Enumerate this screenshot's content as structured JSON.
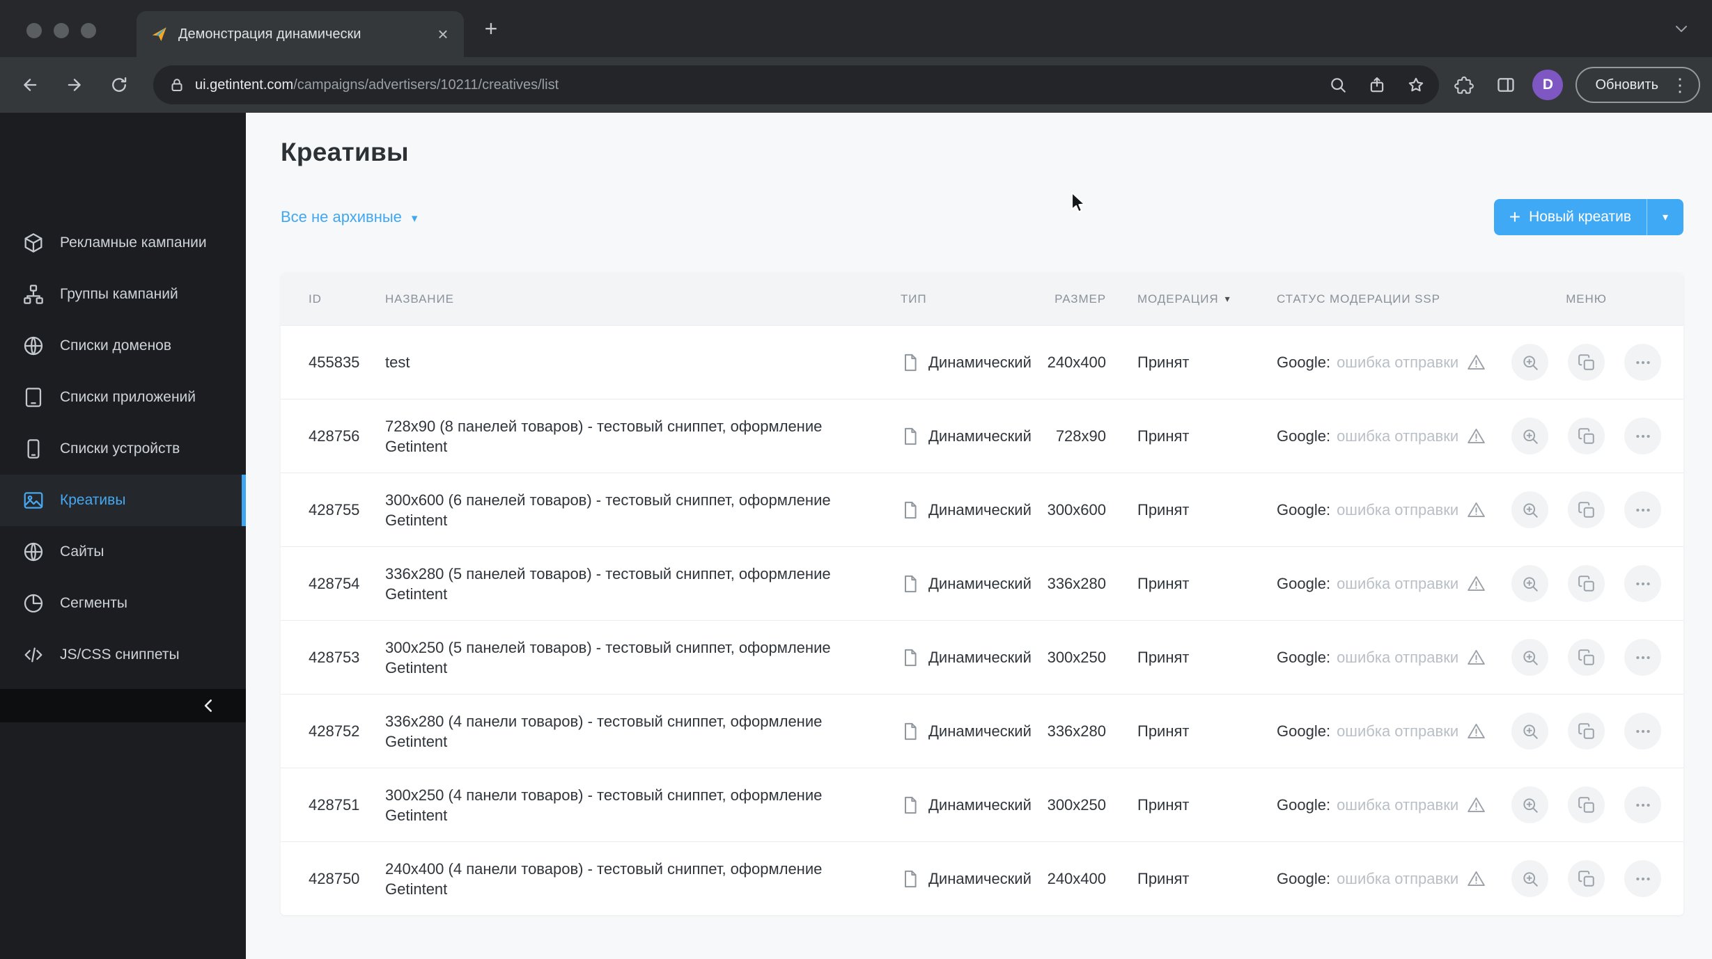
{
  "colors": {
    "accent": "#41a7ef",
    "sidebar_bg": "#1b1d20",
    "page_bg": "#f7f8f9"
  },
  "glyphs": {
    "caret_down": "▾",
    "close": "×",
    "plus": "+",
    "kebab": "⋮"
  },
  "browser": {
    "tab_title": "Демонстрация динамически",
    "url_host": "ui.getintent.com",
    "url_path": "/campaigns/advertisers/10211/creatives/list",
    "update_label": "Обновить",
    "avatar_letter": "D"
  },
  "sidebar": {
    "items": [
      {
        "label": "Рекламные кампании",
        "icon": "cube",
        "active": false
      },
      {
        "label": "Группы кампаний",
        "icon": "sitemap",
        "active": false
      },
      {
        "label": "Списки доменов",
        "icon": "globe",
        "active": false
      },
      {
        "label": "Списки приложений",
        "icon": "tablet",
        "active": false
      },
      {
        "label": "Списки устройств",
        "icon": "phone",
        "active": false
      },
      {
        "label": "Креативы",
        "icon": "image",
        "active": true
      },
      {
        "label": "Сайты",
        "icon": "globe",
        "active": false
      },
      {
        "label": "Сегменты",
        "icon": "pie",
        "active": false
      },
      {
        "label": "JS/CSS сниппеты",
        "icon": "code",
        "active": false
      }
    ]
  },
  "page": {
    "title": "Креативы",
    "filter_label": "Все не архивные",
    "new_creative_label": "Новый креатив"
  },
  "table": {
    "headers": {
      "id": "ID",
      "name": "НАЗВАНИЕ",
      "type": "ТИП",
      "size": "РАЗМЕР",
      "moderation": "МОДЕРАЦИЯ",
      "ssp": "СТАТУС МОДЕРАЦИИ SSP",
      "menu": "МЕНЮ"
    },
    "rows": [
      {
        "id": "455835",
        "name": "test",
        "type": "Динамический",
        "size": "240x400",
        "moderation": "Принят",
        "ssp_network": "Google:",
        "ssp_status": "ошибка отправки"
      },
      {
        "id": "428756",
        "name": "728x90 (8 панелей товаров) - тестовый сниппет, оформление Getintent",
        "type": "Динамический",
        "size": "728x90",
        "moderation": "Принят",
        "ssp_network": "Google:",
        "ssp_status": "ошибка отправки"
      },
      {
        "id": "428755",
        "name": "300x600 (6 панелей товаров) - тестовый сниппет, оформление Getintent",
        "type": "Динамический",
        "size": "300x600",
        "moderation": "Принят",
        "ssp_network": "Google:",
        "ssp_status": "ошибка отправки"
      },
      {
        "id": "428754",
        "name": "336x280 (5 панелей товаров) - тестовый сниппет, оформление Getintent",
        "type": "Динамический",
        "size": "336x280",
        "moderation": "Принят",
        "ssp_network": "Google:",
        "ssp_status": "ошибка отправки"
      },
      {
        "id": "428753",
        "name": "300x250 (5 панелей товаров) - тестовый сниппет, оформление Getintent",
        "type": "Динамический",
        "size": "300x250",
        "moderation": "Принят",
        "ssp_network": "Google:",
        "ssp_status": "ошибка отправки"
      },
      {
        "id": "428752",
        "name": "336x280 (4 панели товаров) - тестовый сниппет, оформление Getintent",
        "type": "Динамический",
        "size": "336x280",
        "moderation": "Принят",
        "ssp_network": "Google:",
        "ssp_status": "ошибка отправки"
      },
      {
        "id": "428751",
        "name": "300x250 (4 панели товаров) - тестовый сниппет, оформление Getintent",
        "type": "Динамический",
        "size": "300x250",
        "moderation": "Принят",
        "ssp_network": "Google:",
        "ssp_status": "ошибка отправки"
      },
      {
        "id": "428750",
        "name": "240x400 (4 панели товаров) - тестовый сниппет, оформление Getintent",
        "type": "Динамический",
        "size": "240x400",
        "moderation": "Принят",
        "ssp_network": "Google:",
        "ssp_status": "ошибка отправки"
      }
    ]
  }
}
